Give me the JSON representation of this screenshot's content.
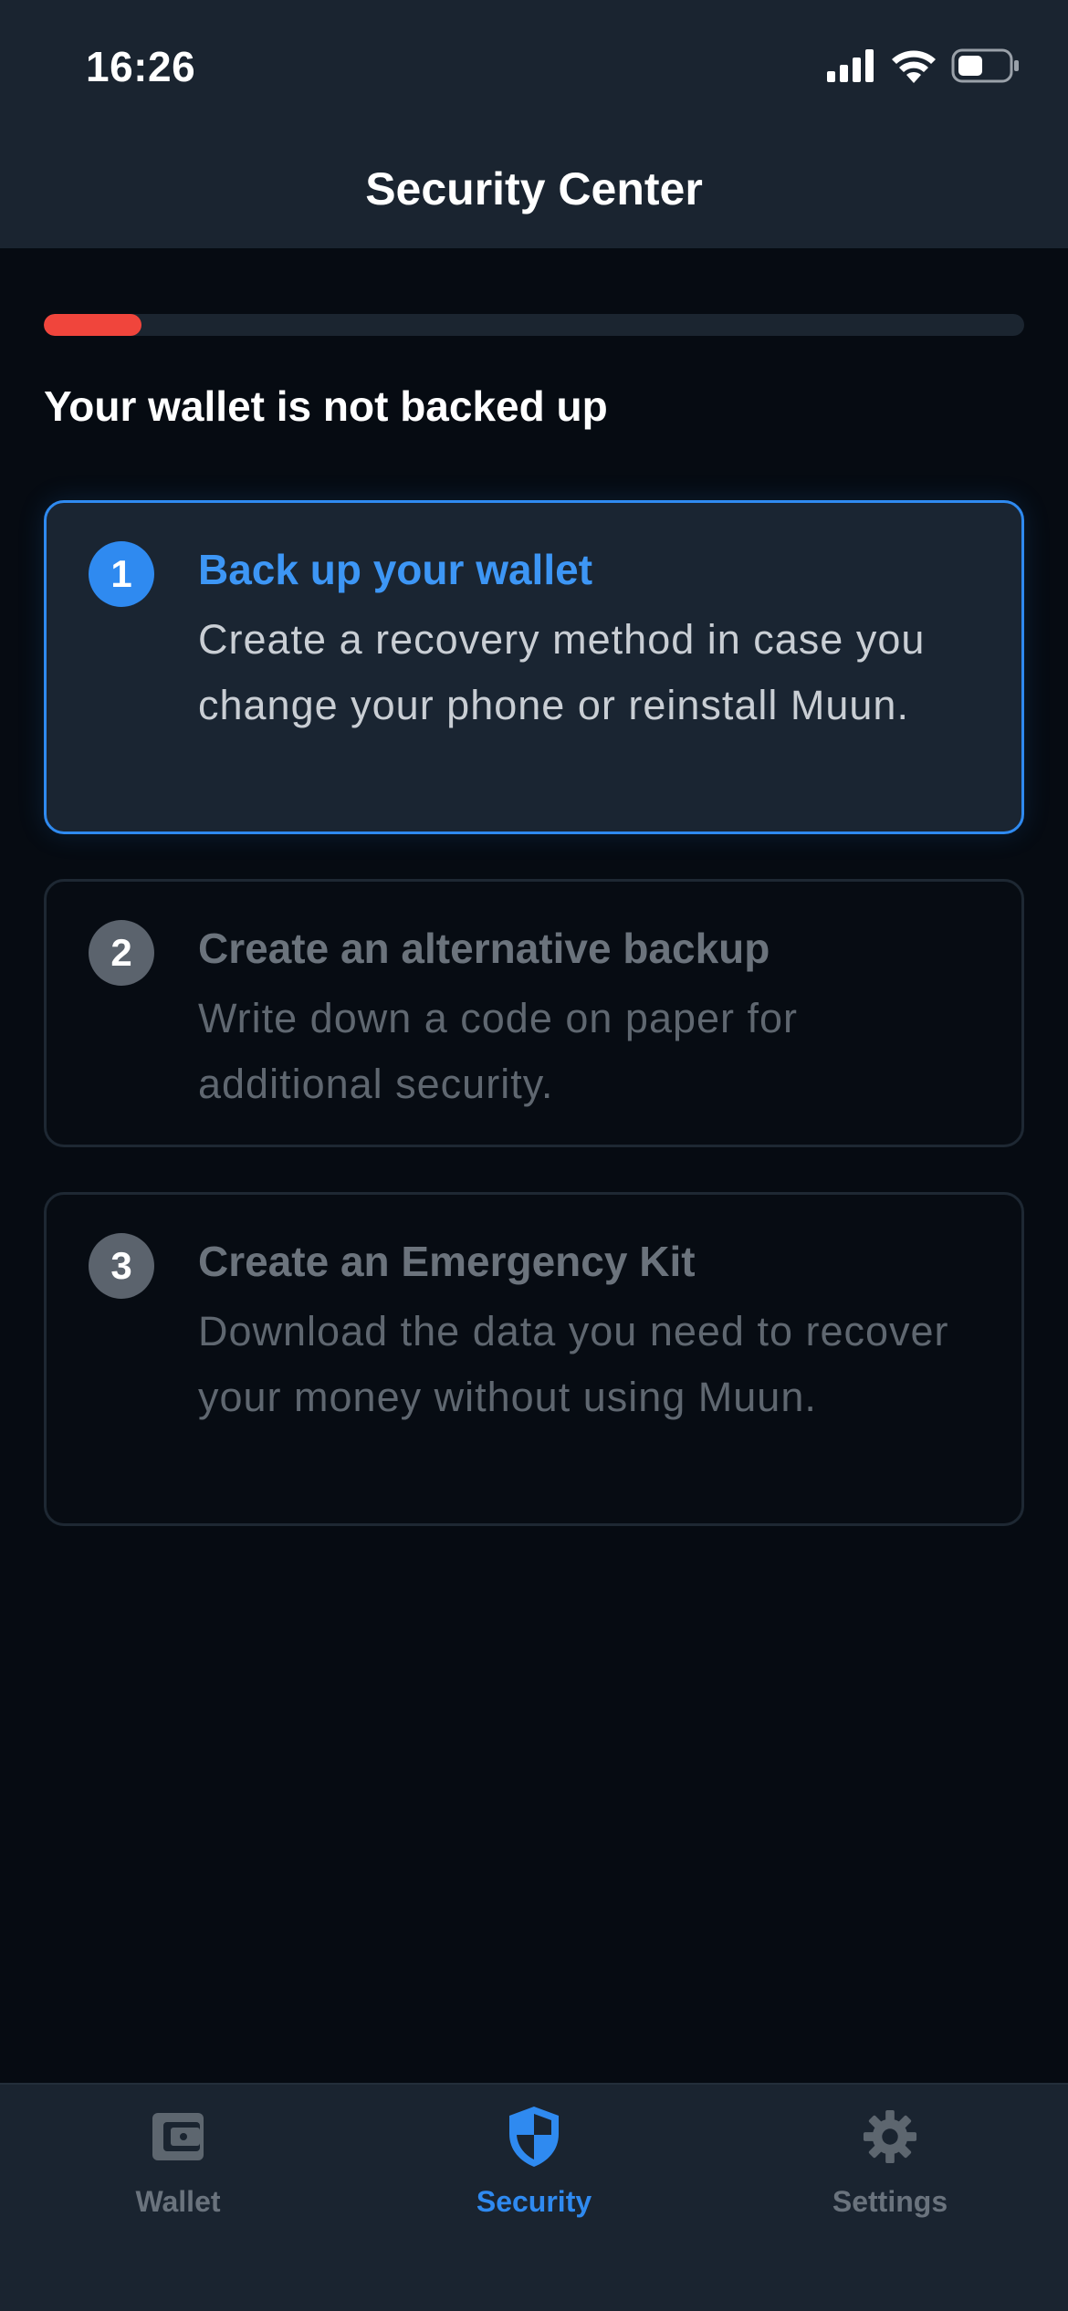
{
  "status_bar": {
    "time": "16:26",
    "icons": [
      "signal-icon",
      "wifi-icon",
      "battery-icon"
    ]
  },
  "nav": {
    "title": "Security Center"
  },
  "progress": {
    "fraction": 0.1,
    "color": "#f0453c"
  },
  "backup_status": "Your wallet is not backed up",
  "steps": [
    {
      "number": "1",
      "title": "Back up your wallet",
      "description": "Create a recovery method in case you change your phone or reinstall Muun.",
      "active": true
    },
    {
      "number": "2",
      "title": "Create an alternative backup",
      "description": "Write down a code on paper for additional security.",
      "active": false
    },
    {
      "number": "3",
      "title": "Create an Emergency Kit",
      "description": "Download the data you need to recover your money without using Muun.",
      "active": false
    }
  ],
  "tabs": [
    {
      "label": "Wallet",
      "icon": "wallet-icon",
      "active": false
    },
    {
      "label": "Security",
      "icon": "shield-icon",
      "active": true
    },
    {
      "label": "Settings",
      "icon": "gear-icon",
      "active": false
    }
  ],
  "colors": {
    "accent": "#2f8af0",
    "danger": "#f0453c",
    "background": "#060b12",
    "surface": "#1a2430"
  }
}
